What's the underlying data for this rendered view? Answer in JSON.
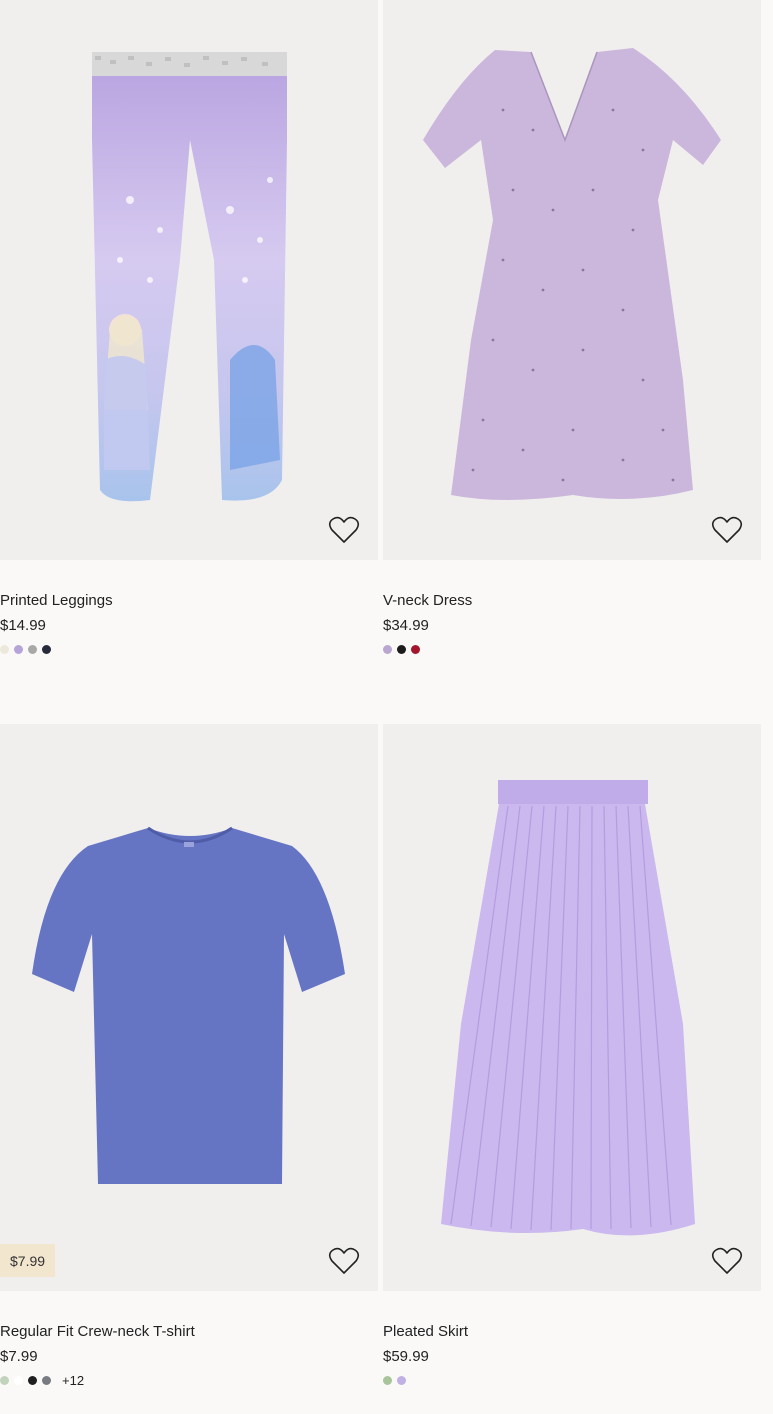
{
  "products": [
    {
      "name": "Printed Leggings",
      "price": "$14.99",
      "badge": "",
      "swatches": [
        "#ece8dc",
        "#b6a4d8",
        "#a8a8a8",
        "#262a3a"
      ],
      "more": "",
      "bg": "#efefef",
      "garment_color": "#c8b7e6"
    },
    {
      "name": "V-neck Dress",
      "price": "$34.99",
      "badge": "",
      "swatches": [
        "#b9a6d1",
        "#1c1c1c",
        "#a3152a"
      ],
      "more": "",
      "bg": "#efefef",
      "garment_color": "#cbb7dc"
    },
    {
      "name": "Regular Fit Crew-neck T-shirt",
      "price": "$7.99",
      "badge": "$7.99",
      "swatches": [
        "#c2d3bb",
        "#ffffff",
        "#1f1f1f",
        "#777c82"
      ],
      "more": "+12",
      "bg": "#efefef",
      "garment_color": "#6674c4"
    },
    {
      "name": "Pleated Skirt",
      "price": "$59.99",
      "badge": "",
      "swatches": [
        "#a8c49b",
        "#c1b0e3"
      ],
      "more": "",
      "bg": "#eeeeee",
      "garment_color": "#cbb8ee"
    }
  ]
}
